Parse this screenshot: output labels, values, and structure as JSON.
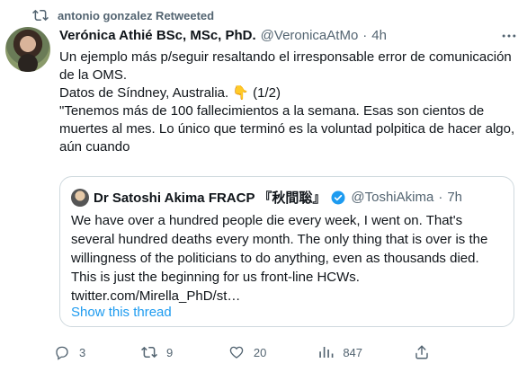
{
  "retweet": {
    "label": "antonio gonzalez Retweeted"
  },
  "tweet": {
    "author_name": "Verónica Athié BSc, MSc, PhD.",
    "handle": "@VeronicaAtMo",
    "separator": "·",
    "time": "4h",
    "paragraph1": "Un ejemplo más p/seguir resaltando el irresponsable error de comunicación de la OMS.",
    "paragraph2": "Datos de Síndney, Australia. 👇 (1/2)",
    "paragraph3": "\"Tenemos más de 100 fallecimientos a la semana. Esas son cientos de muertes al mes. Lo único que terminó es la voluntad polpitica de hacer algo, aún cuando"
  },
  "quote": {
    "author_name": "Dr Satoshi Akima FRACP 『秋間聡』",
    "handle": "@ToshiAkima",
    "separator": "·",
    "time": "7h",
    "text": "We have over a hundred people die every week, I went on. That's several hundred deaths every month. The only thing that is over is the willingness of the politicians to do anything, even as thousands died. This is just the beginning for us front-line HCWs. twitter.com/Mirella_PhD/st…",
    "show_thread": "Show this thread"
  },
  "actions": {
    "reply_count": "3",
    "retweet_count": "9",
    "like_count": "20",
    "view_count": "847"
  },
  "icons": {
    "retweet": "retweet-icon",
    "more": "more-icon",
    "verified": "verified-badge-icon",
    "reply": "reply-icon",
    "like": "heart-icon",
    "views": "views-icon",
    "share": "share-icon"
  },
  "colors": {
    "accent": "#1d9bf0",
    "muted": "#536471",
    "text": "#0f1419"
  }
}
